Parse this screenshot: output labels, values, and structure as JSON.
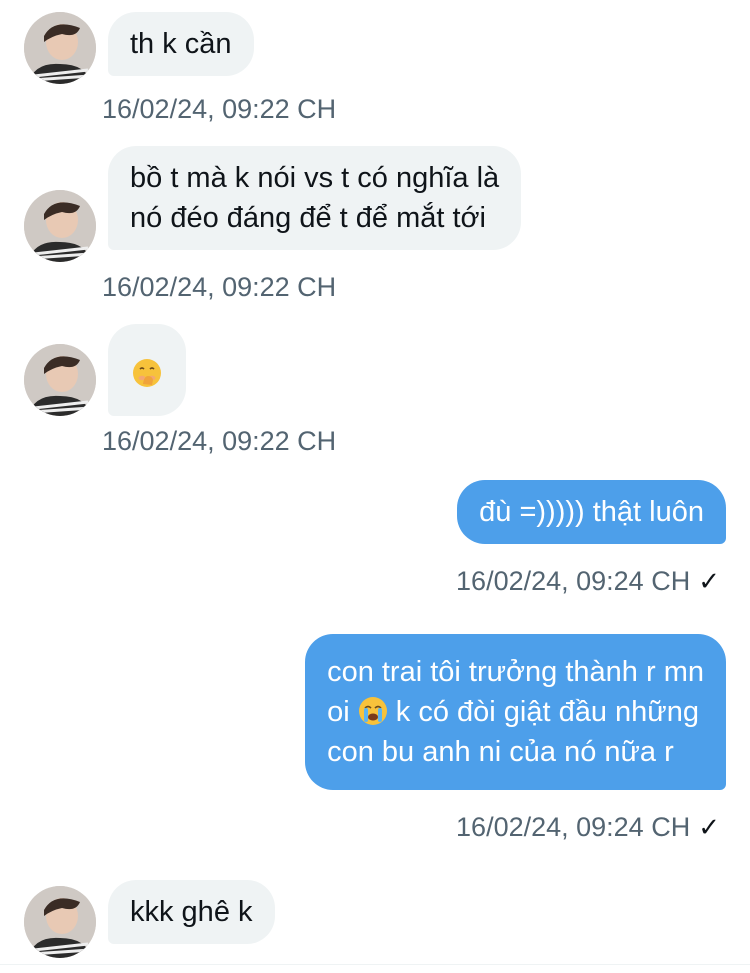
{
  "messages": [
    {
      "direction": "in",
      "lines": [
        "th k cần"
      ],
      "time": "16/02/24, 09:22 CH"
    },
    {
      "direction": "in",
      "lines": [
        "bồ t mà k nói vs t có nghĩa là",
        "nó đéo đáng để t để mắt tới"
      ],
      "time": "16/02/24, 09:22 CH"
    },
    {
      "direction": "in",
      "emoji": "hand-over-mouth-emoji",
      "time": "16/02/24, 09:22 CH"
    },
    {
      "direction": "out",
      "lines": [
        "đù =))))) thật luôn"
      ],
      "time": "16/02/24, 09:24 CH",
      "status": "✓"
    },
    {
      "direction": "out",
      "lines": [
        "con trai tôi trưởng thành r mn",
        "oi",
        "k có đòi giật đầu những",
        "con bu anh ni của nó nữa r"
      ],
      "emoji": "loudly-crying-emoji",
      "time": "16/02/24, 09:24 CH",
      "status": "✓"
    },
    {
      "direction": "in",
      "lines": [
        "kkk ghê k"
      ]
    }
  ],
  "colors": {
    "incoming_bubble": "#eff3f4",
    "outgoing_bubble": "#4d9fea",
    "timestamp": "#536471"
  }
}
